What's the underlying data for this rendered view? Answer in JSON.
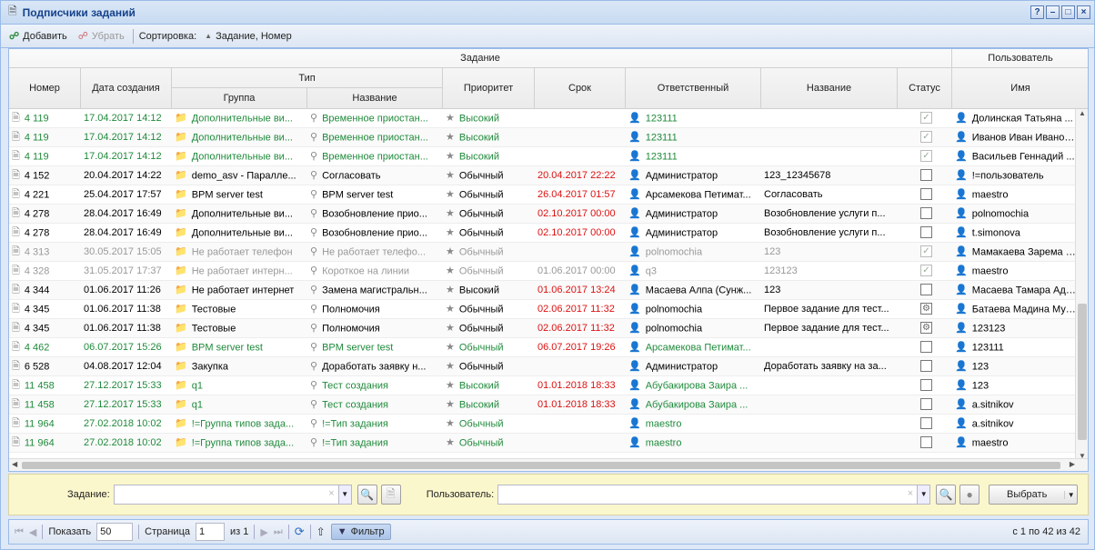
{
  "window": {
    "title": "Подписчики заданий"
  },
  "toolbar": {
    "add": "Добавить",
    "remove": "Убрать",
    "sort_label": "Сортировка:",
    "sort_value": "Задание, Номер"
  },
  "header": {
    "group_task": "Задание",
    "group_user": "Пользователь",
    "group_type": "Тип",
    "col_number": "Номер",
    "col_created": "Дата создания",
    "col_type_group": "Группа",
    "col_type_name": "Название",
    "col_priority": "Приоритет",
    "col_deadline": "Срок",
    "col_responsible": "Ответственный",
    "col_name": "Название",
    "col_status": "Статус",
    "col_user_name": "Имя"
  },
  "rows": [
    {
      "num": "4 119",
      "created": "17.04.2017 14:12",
      "group": "Дополнительные ви...",
      "tname": "Временное приостан...",
      "priority": "Высокий",
      "deadline": "",
      "resp": "123111",
      "name": "",
      "status": "checked",
      "user": "Долинская Татьяна ...",
      "color": "green"
    },
    {
      "num": "4 119",
      "created": "17.04.2017 14:12",
      "group": "Дополнительные ви...",
      "tname": "Временное приостан...",
      "priority": "Высокий",
      "deadline": "",
      "resp": "123111",
      "name": "",
      "status": "checked",
      "user": "Иванов Иван Иванов...",
      "color": "green"
    },
    {
      "num": "4 119",
      "created": "17.04.2017 14:12",
      "group": "Дополнительные ви...",
      "tname": "Временное приостан...",
      "priority": "Высокий",
      "deadline": "",
      "resp": "123111",
      "name": "",
      "status": "checked",
      "user": "Васильев Геннадий ...",
      "color": "green"
    },
    {
      "num": "4 152",
      "created": "20.04.2017 14:22",
      "group": "demo_asv - Паралле...",
      "tname": "Согласовать",
      "priority": "Обычный",
      "deadline": "20.04.2017 22:22",
      "resp": "Администратор",
      "name": "123_12345678",
      "status": "empty",
      "user": "!=пользователь",
      "color": "black"
    },
    {
      "num": "4 221",
      "created": "25.04.2017 17:57",
      "group": "BPM server test",
      "tname": "BPM server test",
      "priority": "Обычный",
      "deadline": "26.04.2017 01:57",
      "resp": "Арсамекова Петимат...",
      "name": "Согласовать",
      "status": "empty",
      "user": "maestro",
      "color": "black"
    },
    {
      "num": "4 278",
      "created": "28.04.2017 16:49",
      "group": "Дополнительные ви...",
      "tname": "Возобновление прио...",
      "priority": "Обычный",
      "deadline": "02.10.2017 00:00",
      "resp": "Администратор",
      "name": "Возобновление услуги п...",
      "status": "empty",
      "user": "polnomochia",
      "color": "black"
    },
    {
      "num": "4 278",
      "created": "28.04.2017 16:49",
      "group": "Дополнительные ви...",
      "tname": "Возобновление прио...",
      "priority": "Обычный",
      "deadline": "02.10.2017 00:00",
      "resp": "Администратор",
      "name": "Возобновление услуги п...",
      "status": "empty",
      "user": "t.simonova",
      "color": "black"
    },
    {
      "num": "4 313",
      "created": "30.05.2017 15:05",
      "group": "Не работает телефон",
      "tname": "Не работает телефо...",
      "priority": "Обычный",
      "deadline": "",
      "resp": "polnomochia",
      "name": "123",
      "status": "checked",
      "user": "Мамакаева Зарема В...",
      "color": "gray"
    },
    {
      "num": "4 328",
      "created": "31.05.2017 17:37",
      "group": "Не работает интерн...",
      "tname": "Короткое на линии",
      "priority": "Обычный",
      "deadline": "01.06.2017 00:00",
      "resp": "q3",
      "name": "123123",
      "status": "checked",
      "user": "maestro",
      "color": "gray"
    },
    {
      "num": "4 344",
      "created": "01.06.2017 11:26",
      "group": "Не работает интернет",
      "tname": "Замена магистральн...",
      "priority": "Высокий",
      "deadline": "01.06.2017 13:24",
      "resp": "Масаева Алпа (Сунж...",
      "name": "123",
      "status": "empty",
      "user": "Масаева Тамара Ада...",
      "color": "black"
    },
    {
      "num": "4 345",
      "created": "01.06.2017 11:38",
      "group": "Тестовые",
      "tname": "Полномочия",
      "priority": "Обычный",
      "deadline": "02.06.2017 11:32",
      "resp": "polnomochia",
      "name": "Первое задание для тест...",
      "status": "gear",
      "user": "Батаева Мадина Мус...",
      "color": "black"
    },
    {
      "num": "4 345",
      "created": "01.06.2017 11:38",
      "group": "Тестовые",
      "tname": "Полномочия",
      "priority": "Обычный",
      "deadline": "02.06.2017 11:32",
      "resp": "polnomochia",
      "name": "Первое задание для тест...",
      "status": "gear",
      "user": "123123",
      "color": "black"
    },
    {
      "num": "4 462",
      "created": "06.07.2017 15:26",
      "group": "BPM server test",
      "tname": "BPM server test",
      "priority": "Обычный",
      "deadline": "06.07.2017 19:26",
      "resp": "Арсамекова Петимат...",
      "name": "",
      "status": "empty",
      "user": "123111",
      "color": "green"
    },
    {
      "num": "6 528",
      "created": "04.08.2017 12:04",
      "group": "Закупка",
      "tname": "Доработать заявку н...",
      "priority": "Обычный",
      "deadline": "",
      "resp": "Администратор",
      "name": "Доработать заявку на за...",
      "status": "empty",
      "user": "123",
      "color": "black"
    },
    {
      "num": "11 458",
      "created": "27.12.2017 15:33",
      "group": "q1",
      "tname": "Тест создания",
      "priority": "Высокий",
      "deadline": "01.01.2018 18:33",
      "resp": "Абубакирова Заира ...",
      "name": "",
      "status": "empty",
      "user": "123",
      "color": "green"
    },
    {
      "num": "11 458",
      "created": "27.12.2017 15:33",
      "group": "q1",
      "tname": "Тест создания",
      "priority": "Высокий",
      "deadline": "01.01.2018 18:33",
      "resp": "Абубакирова Заира ...",
      "name": "",
      "status": "empty",
      "user": "a.sitnikov",
      "color": "green"
    },
    {
      "num": "11 964",
      "created": "27.02.2018 10:02",
      "group": "!=Группа типов зада...",
      "tname": "!=Тип задания",
      "priority": "Обычный",
      "deadline": "",
      "resp": "maestro",
      "name": "",
      "status": "empty",
      "user": "a.sitnikov",
      "color": "green"
    },
    {
      "num": "11 964",
      "created": "27.02.2018 10:02",
      "group": "!=Группа типов зада...",
      "tname": "!=Тип задания",
      "priority": "Обычный",
      "deadline": "",
      "resp": "maestro",
      "name": "",
      "status": "empty",
      "user": "maestro",
      "color": "green"
    }
  ],
  "filter": {
    "task_label": "Задание:",
    "task_value": "",
    "user_label": "Пользователь:",
    "user_value": "",
    "select_button": "Выбрать"
  },
  "pager": {
    "show_label": "Показать",
    "page_size": "50",
    "page_label": "Страница",
    "page": "1",
    "of": "из 1",
    "filter_button": "Фильтр",
    "summary": "с 1 по 42 из 42"
  },
  "colors": {
    "green": "#1f8a3b",
    "red": "#dd1111",
    "gray": "#999999",
    "header_bg": "#dae7f6"
  }
}
